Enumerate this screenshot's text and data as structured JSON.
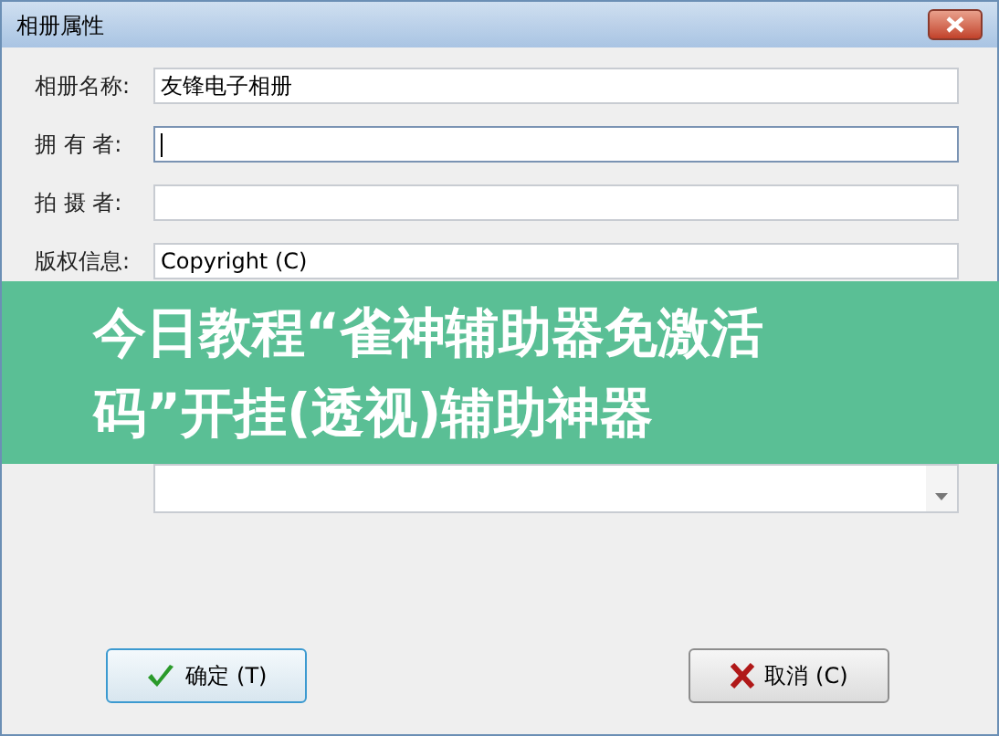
{
  "window": {
    "title": "相册属性"
  },
  "fields": [
    {
      "label": "相册名称:",
      "value": "友锋电子相册",
      "focused": false
    },
    {
      "label": "拥 有 者:",
      "focused": true
    },
    {
      "label": "拍 摄 者:",
      "focused": false
    },
    {
      "label": "版权信息:",
      "value": "Copyright (C)",
      "focused": false
    }
  ],
  "buttons": [
    {
      "kind": "ok",
      "label": "确定 (T)"
    },
    {
      "kind": "cancel",
      "label": "取消 (C)"
    }
  ],
  "banner": {
    "text": "今日教程“雀神辅助器免激活码”开挂(透视)辅助神器"
  }
}
